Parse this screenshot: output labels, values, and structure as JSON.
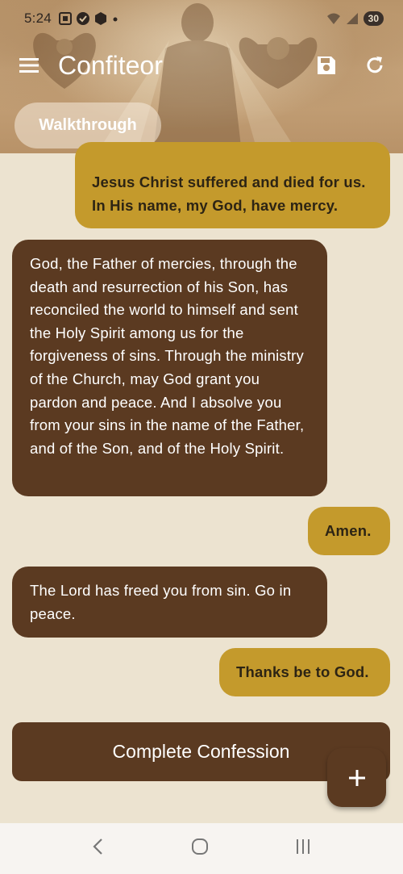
{
  "status_bar": {
    "time": "5:24",
    "battery": "30",
    "icons": [
      "screenshot-icon",
      "check-circle-icon",
      "cube-icon",
      "dot-icon",
      "wifi-icon",
      "signal-icon",
      "battery-icon"
    ]
  },
  "toolbar": {
    "title": "Confiteor",
    "icons": [
      "menu-icon",
      "save-icon",
      "refresh-icon"
    ]
  },
  "chip": {
    "label": "Walkthrough"
  },
  "messages": [
    {
      "role": "user",
      "text": "Jesus Christ suffered and died for us. In His name, my God, have mercy."
    },
    {
      "role": "priest",
      "text": "God, the Father of mercies, through the death and resurrection of his Son, has reconciled the world to himself and sent the Holy Spirit among us for the forgiveness of sins. Through the ministry of the Church, may God grant you pardon and peace. And I absolve you from your sins in the name of the Father, and of the Son, and of the Holy Spirit."
    },
    {
      "role": "user",
      "text": "Amen."
    },
    {
      "role": "priest",
      "text": "The Lord has freed you from sin. Go in peace."
    },
    {
      "role": "user",
      "text": "Thanks be to God."
    }
  ],
  "complete_button": {
    "label": "Complete Confession"
  },
  "fab": {
    "icon": "plus-icon"
  },
  "nav": {
    "icons": [
      "back-icon",
      "home-icon",
      "recents-icon"
    ]
  },
  "colors": {
    "user_bubble": "#c49a2c",
    "priest_bubble": "#5b3a21",
    "background": "#ece3d0",
    "nav_bar": "#f7f4f1"
  }
}
